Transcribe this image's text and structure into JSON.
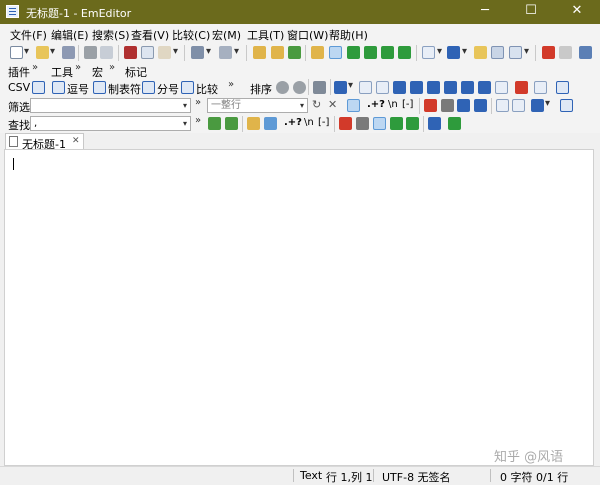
{
  "window": {
    "title": "无标题-1 - EmEditor",
    "min": "─",
    "max": "☐",
    "close": "✕"
  },
  "menu": [
    "文件(F)",
    "编辑(E)",
    "搜索(S)",
    "查看(V)",
    "比较(C)",
    "宏(M)",
    "工具(T)",
    "窗口(W)",
    "帮助(H)"
  ],
  "toolbars": {
    "plugins": "插件",
    "tools": "工具",
    "macros": "宏",
    "marks": "标记",
    "csv": "CSV",
    "comma": "逗号",
    "tab": "制表符",
    "semicolon": "分号",
    "compare": "比较",
    "sort": "排序"
  },
  "filter": {
    "label": "筛选",
    "line_placeholder": "一整行",
    "regex1": ".+?",
    "regex2": "\\n",
    "regex3": "[-]"
  },
  "find": {
    "label": "查找",
    "value": ",",
    "regex1": ".+?",
    "regex2": "\\n",
    "regex3": "[-]"
  },
  "doc_tab": {
    "name": "无标题-1",
    "close": "✕"
  },
  "status": {
    "mode": "Text",
    "position": "行 1,列 1",
    "encoding": "UTF-8 无签名",
    "chars": "0 字符",
    "lines": "0/1 行"
  },
  "watermark": "知乎 @风语",
  "colors": {
    "titlebar": "#6b6a1c",
    "blue_icon": "#2f63b5",
    "green_icon": "#2e9b3c",
    "red_icon": "#d23a2a"
  }
}
